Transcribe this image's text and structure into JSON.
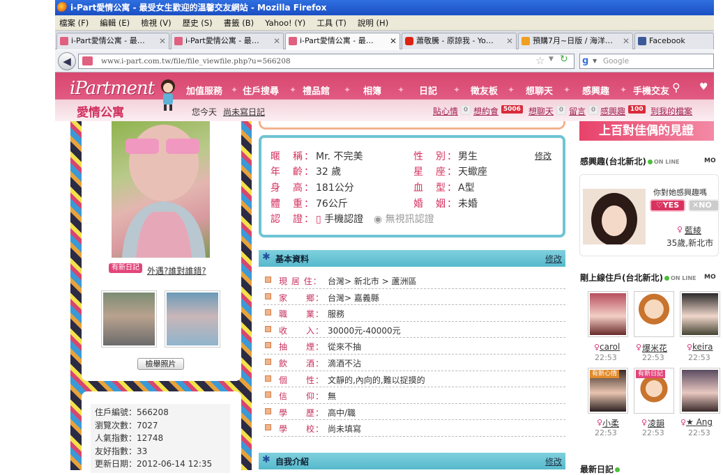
{
  "window": {
    "title": "i-Part愛情公寓 - 最受女生歡迎的溫馨交友網站 - Mozilla Firefox"
  },
  "menu": [
    "檔案 (F)",
    "編輯 (E)",
    "檢視 (V)",
    "歷史 (S)",
    "書籤 (B)",
    "Yahoo! (Y)",
    "工具 (T)",
    "說明 (H)"
  ],
  "tabs": [
    {
      "label": "i-Part愛情公寓 - 最…",
      "icon": "ipart-favicon",
      "active": false
    },
    {
      "label": "i-Part愛情公寓 - 最…",
      "icon": "ipart-favicon",
      "active": false
    },
    {
      "label": "i-Part愛情公寓 - 最…",
      "icon": "ipart-favicon",
      "active": true
    },
    {
      "label": "蕭敬騰 - 原諒我 - Yo…",
      "icon": "youtube-favicon",
      "active": false
    },
    {
      "label": "預購7月~日版 / 海洋…",
      "icon": "shop-favicon",
      "active": false
    },
    {
      "label": "Facebook",
      "icon": "facebook-favicon",
      "active": false
    }
  ],
  "navbar": {
    "url": "www.i-part.com.tw/file/file_viewfile.php?u=566208",
    "search_placeholder": "Google"
  },
  "site": {
    "logo": "iPartment",
    "logo_cn": "愛情公寓",
    "nav": [
      "加值服務",
      "住戶搜尋",
      "禮品館",
      "相簿",
      "日記",
      "徵友板",
      "想聊天",
      "感興趣",
      "手機交友"
    ],
    "today_label": "您今天",
    "today_link": "尚未寫日記",
    "quick": [
      {
        "label": "貼心情",
        "count": "0"
      },
      {
        "label": "想約會",
        "count": "5006"
      },
      {
        "label": "想聊天",
        "count": "0"
      },
      {
        "label": "留言",
        "count": "0"
      },
      {
        "label": "感興趣",
        "count": "100"
      },
      {
        "label": "到我的檔案",
        "count": ""
      }
    ],
    "colors": {
      "brand_pink": "#d8476f",
      "teal": "#6fc4d3",
      "label_pink": "#d4305e"
    }
  },
  "left": {
    "new_diary_badge": "有新日記",
    "diary_link": "外遇?誰對誰錯?",
    "report_button": "檢舉照片",
    "stats": [
      {
        "label": "住戶編號：",
        "value": "566208"
      },
      {
        "label": "瀏覽次數：",
        "value": "7027"
      },
      {
        "label": "人氣指數：",
        "value": "12748"
      },
      {
        "label": "友好指數：",
        "value": "33"
      },
      {
        "label": "更新日期：",
        "value": "2012-06-14 12:35"
      }
    ]
  },
  "profile": {
    "edit": "修改",
    "nick_label": "暱　稱：",
    "nick": "Mr. 不完美",
    "age_label": "年　齡：",
    "age": "32 歲",
    "height_label": "身　高：",
    "height": "181公分",
    "weight_label": "體　重：",
    "weight": "76公斤",
    "verify_label": "認　證：",
    "verify_phone": "手機認證",
    "verify_video": "無視訊認證",
    "gender_label": "性　別：",
    "gender": "男生",
    "zodiac_label": "星　座：",
    "zodiac": "天蠍座",
    "blood_label": "血　型：",
    "blood": "A型",
    "marital_label": "婚　姻：",
    "marital": "未婚"
  },
  "basic": {
    "title": "基本資料",
    "edit": "修改",
    "rows": [
      {
        "label": "現 居 住：",
        "value": "台灣> 新北市 > 蘆洲區"
      },
      {
        "label": "家　　鄉：",
        "value": "台灣> 嘉義縣"
      },
      {
        "label": "職　　業：",
        "value": "服務"
      },
      {
        "label": "收　　入：",
        "value": "30000元-40000元"
      },
      {
        "label": "抽　　煙：",
        "value": "從來不抽"
      },
      {
        "label": "飲　　酒：",
        "value": "滴酒不沾"
      },
      {
        "label": "個　　性：",
        "value": "文靜的,內向的,難以捉摸的"
      },
      {
        "label": "信　　仰：",
        "value": "無"
      },
      {
        "label": "學　　歷：",
        "value": "高中/職"
      },
      {
        "label": "學　　校：",
        "value": "尚未填寫"
      }
    ]
  },
  "intro": {
    "title": "自我介紹",
    "edit": "修改"
  },
  "right": {
    "banner": "上百對佳偶的見證",
    "interest_title": "感興趣(台北新北)",
    "online_txt": "ON LINE",
    "more": "MO",
    "ask": "你對她感興趣嗎",
    "yes": "♡YES",
    "no": "✕NO",
    "girl_name": "藍綾",
    "girl_info": "35歲,新北市",
    "online_title": "剛上線住戶(台北新北)",
    "users": [
      {
        "name": "carol",
        "time": "22:53",
        "tag": ""
      },
      {
        "name": "爆米花",
        "time": "22:53",
        "tag": ""
      },
      {
        "name": "keira",
        "time": "22:53",
        "tag": ""
      },
      {
        "name": "小柔",
        "time": "22:53",
        "tag": "有新心情"
      },
      {
        "name": "凌韻",
        "time": "22:53",
        "tag": "有新日記"
      },
      {
        "name": "★ Ang",
        "time": "22:53",
        "tag": ""
      }
    ],
    "bottom_title": "最新日記"
  }
}
